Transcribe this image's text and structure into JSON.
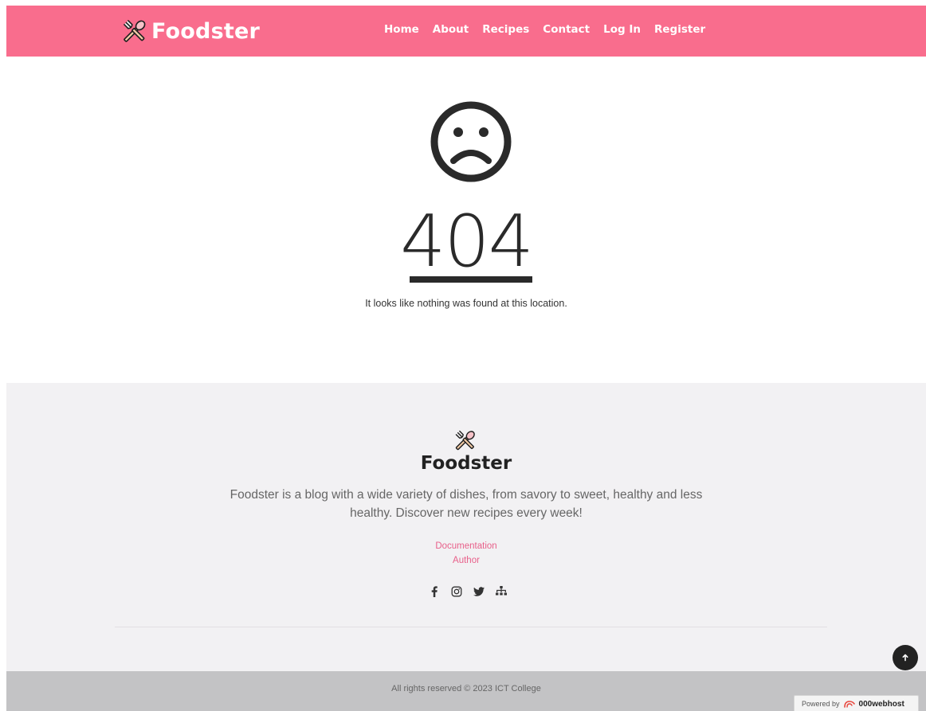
{
  "header": {
    "brand": "Foodster",
    "nav": [
      "Home",
      "About",
      "Recipes",
      "Contact",
      "Log In",
      "Register"
    ]
  },
  "error": {
    "code": "404",
    "message": "It looks like nothing was found at this location."
  },
  "footer": {
    "title": "Foodster",
    "description": "Foodster is a blog with a wide variety of dishes, from savory to sweet, healthy and less healthy. Discover new recipes every week!",
    "links": [
      "Documentation",
      "Author"
    ],
    "socials": [
      "facebook-icon",
      "instagram-icon",
      "twitter-icon",
      "sitemap-icon"
    ]
  },
  "bottom": {
    "copyright": "All rights reserved © 2023 ICT College",
    "powered_label": "Powered by",
    "powered_brand": "000webhost"
  },
  "colors": {
    "brand_pink": "#f96d8d",
    "link_pink": "#e8608a",
    "footer_bg": "#f2f1f3",
    "bottom_bg": "#c3c3c5"
  }
}
